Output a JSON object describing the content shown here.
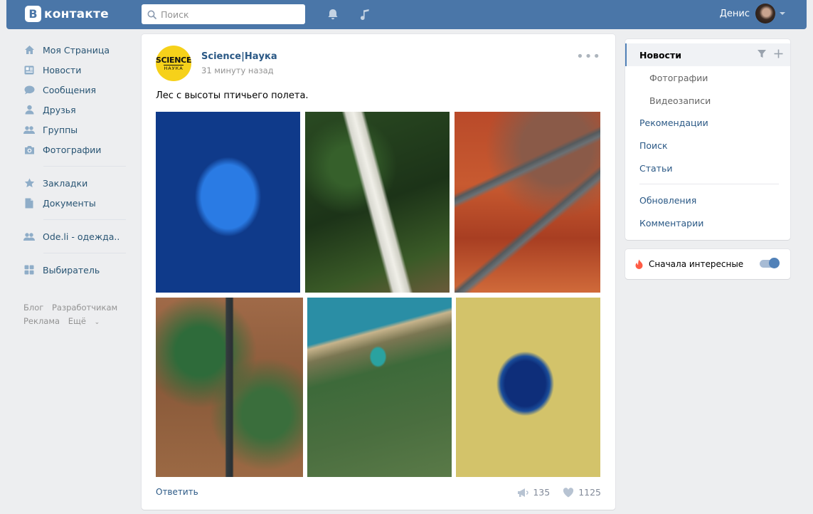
{
  "header": {
    "logo_letter": "В",
    "logo_text": "контакте",
    "search_placeholder": "Поиск",
    "user_name": "Денис"
  },
  "leftnav": {
    "items": [
      {
        "label": "Моя Страница",
        "icon": "home-icon"
      },
      {
        "label": "Новости",
        "icon": "news-icon"
      },
      {
        "label": "Сообщения",
        "icon": "messages-icon"
      },
      {
        "label": "Друзья",
        "icon": "friends-icon"
      },
      {
        "label": "Группы",
        "icon": "groups-icon"
      },
      {
        "label": "Фотографии",
        "icon": "camera-icon"
      }
    ],
    "items2": [
      {
        "label": "Закладки",
        "icon": "star-icon"
      },
      {
        "label": "Документы",
        "icon": "document-icon"
      }
    ],
    "items3": [
      {
        "label": "Ode.li - одежда..",
        "icon": "groups-icon"
      }
    ],
    "items4": [
      {
        "label": "Выбиратель",
        "icon": "apps-icon"
      }
    ],
    "footer": [
      "Блог",
      "Разработчикам",
      "Реклама",
      "Ещё"
    ]
  },
  "post": {
    "avatar_text1": "SCIENCE",
    "avatar_text2": "НАУКА",
    "author": "Science|Наука",
    "time": "31 минуту назад",
    "text": "Лес с высоты птичьего полета.",
    "photos": [
      "forest-lake-photo",
      "forest-river-photo",
      "autumn-road-photo",
      "forest-road-photo",
      "forest-shore-photo",
      "forest-pond-photo"
    ],
    "reply_label": "Ответить",
    "shares": "135",
    "likes": "1125"
  },
  "rightnav": {
    "active": "Новости",
    "items": [
      {
        "label": "Фотографии",
        "sub": true
      },
      {
        "label": "Видеозаписи",
        "sub": true
      },
      {
        "label": "Рекомендации",
        "sub": false
      },
      {
        "label": "Поиск",
        "sub": false
      },
      {
        "label": "Статьи",
        "sub": false
      },
      {
        "label": "Обновления",
        "sub": false
      },
      {
        "label": "Комментарии",
        "sub": false
      }
    ],
    "interesting_label": "Сначала интересные",
    "interesting_on": true
  },
  "colors": {
    "header_bg": "#4a76a8",
    "link": "#2a5885",
    "page_bg": "#edeef0",
    "accent": "#5181b8"
  }
}
